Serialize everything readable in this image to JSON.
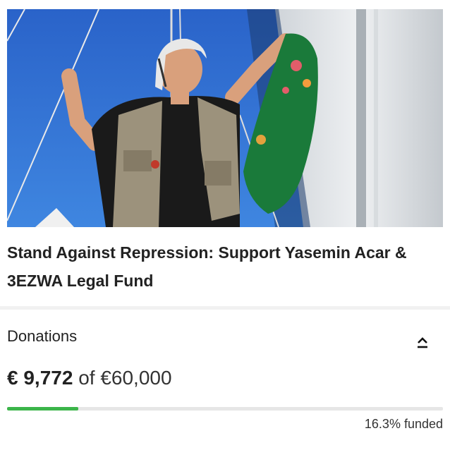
{
  "campaign": {
    "title": "Stand Against Repression: Support Yasemin Acar & 3EZWA Legal Fund"
  },
  "donations": {
    "label": "Donations",
    "raised": "€ 9,772",
    "of_text": "of €60,000",
    "progress_fraction": 0.163,
    "funded_text": "16.3% funded",
    "progress_color": "#3cb54a",
    "collapse_icon": "chevron-up-icon"
  }
}
